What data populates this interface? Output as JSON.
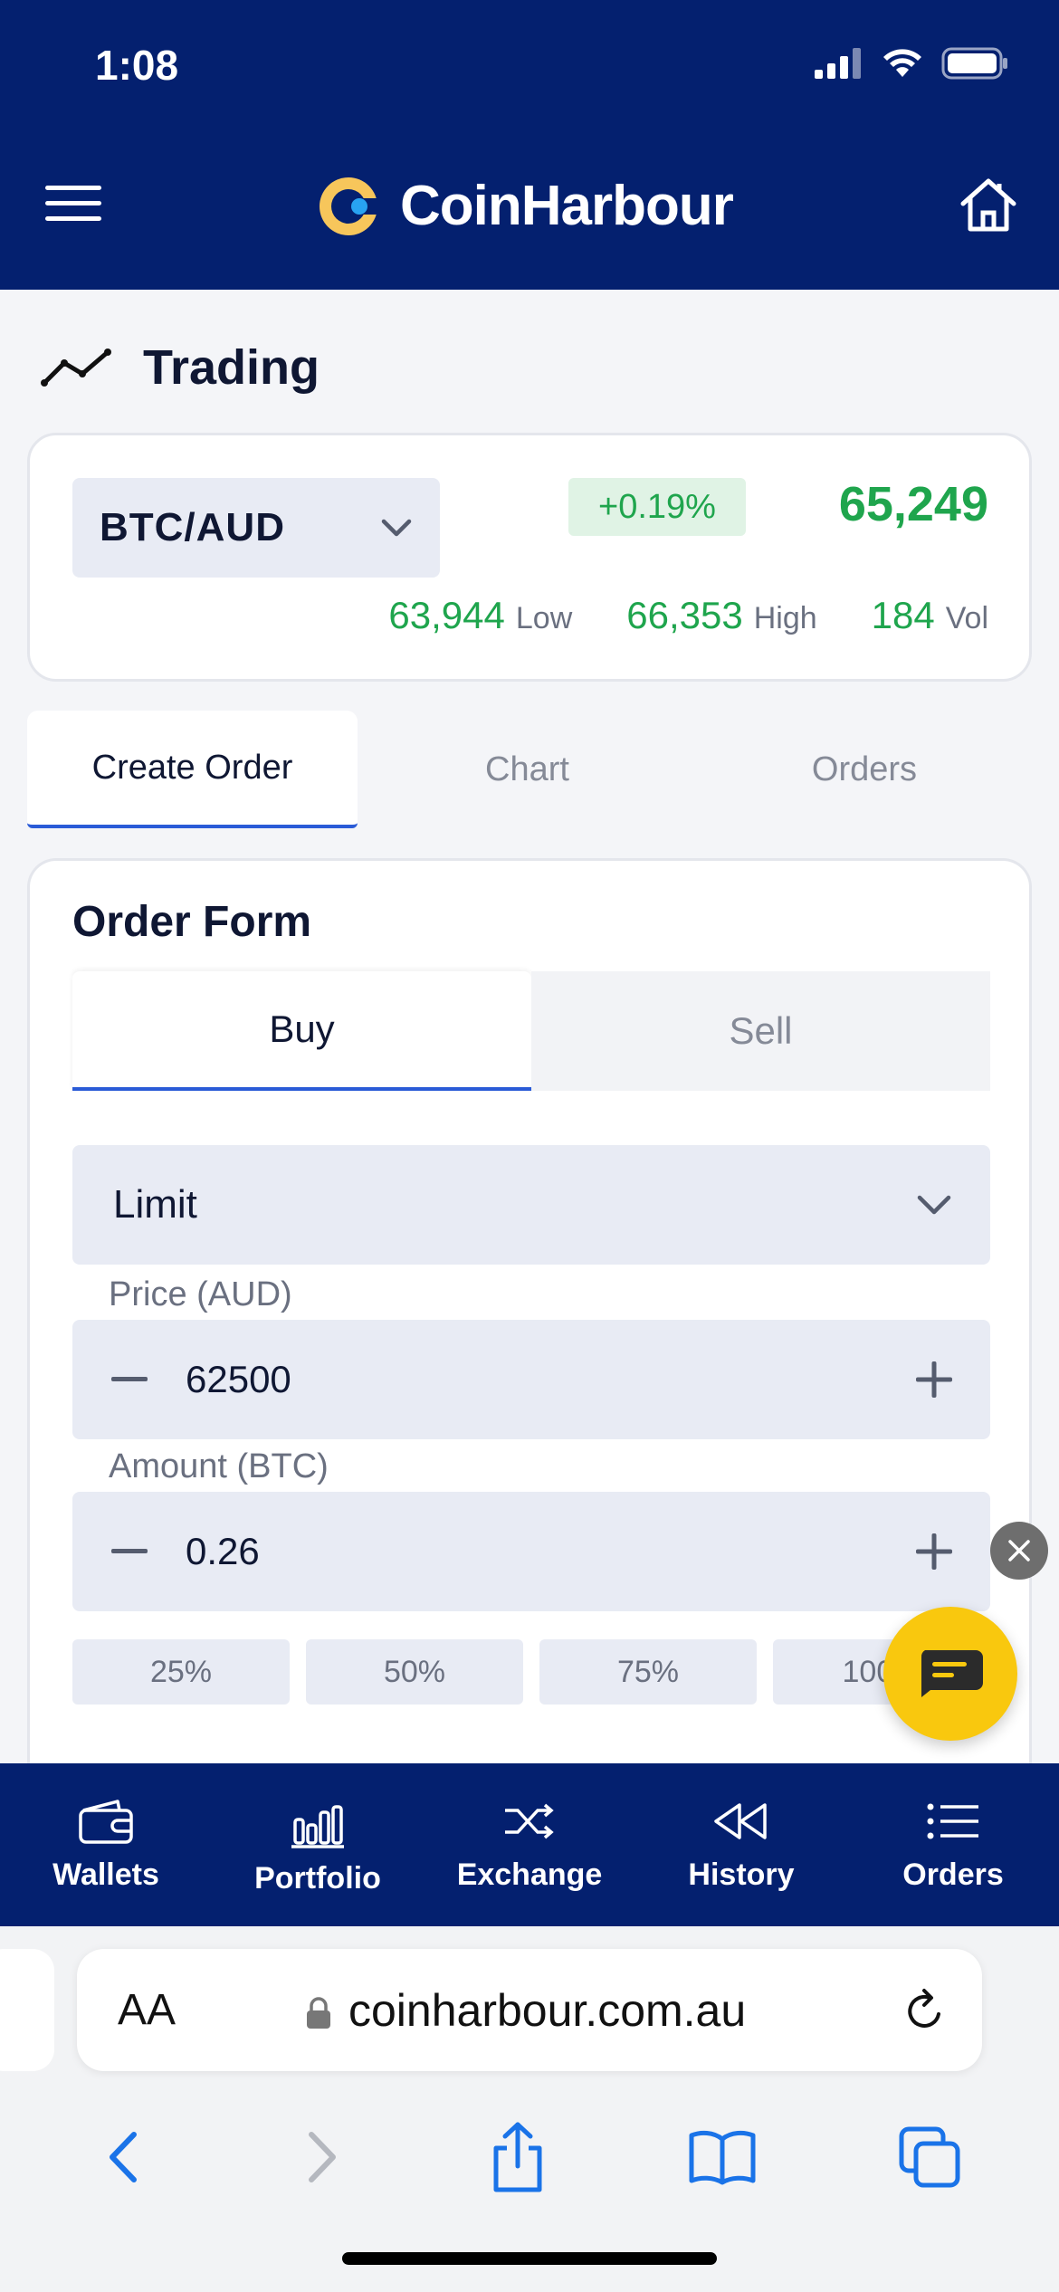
{
  "status_bar": {
    "time": "1:08"
  },
  "header": {
    "brand": "CoinHarbour"
  },
  "page": {
    "title": "Trading"
  },
  "ticker": {
    "pair": "BTC/AUD",
    "change": "+0.19%",
    "price": "65,249",
    "low_value": "63,944",
    "low_label": "Low",
    "high_value": "66,353",
    "high_label": "High",
    "vol_value": "184",
    "vol_label": "Vol"
  },
  "main_tabs": [
    {
      "label": "Create Order",
      "active": true
    },
    {
      "label": "Chart",
      "active": false
    },
    {
      "label": "Orders",
      "active": false
    }
  ],
  "order_form": {
    "title": "Order Form",
    "sides": [
      {
        "label": "Buy",
        "active": true
      },
      {
        "label": "Sell",
        "active": false
      }
    ],
    "order_type": "Limit",
    "price_label": "Price (AUD)",
    "price_value": "62500",
    "amount_label": "Amount (BTC)",
    "amount_value": "0.26",
    "percent_buttons": [
      "25%",
      "50%",
      "75%",
      "100%"
    ]
  },
  "bottom_nav": [
    {
      "label": "Wallets",
      "icon": "wallet-icon"
    },
    {
      "label": "Portfolio",
      "icon": "bar-chart-icon"
    },
    {
      "label": "Exchange",
      "icon": "shuffle-icon"
    },
    {
      "label": "History",
      "icon": "rewind-icon"
    },
    {
      "label": "Orders",
      "icon": "list-icon"
    }
  ],
  "browser": {
    "aa_label": "AA",
    "url": "coinharbour.com.au"
  },
  "colors": {
    "navy": "#04206f",
    "green": "#1fa54d",
    "accent_blue": "#2a5bd7",
    "chat_yellow": "#f9c80e"
  }
}
